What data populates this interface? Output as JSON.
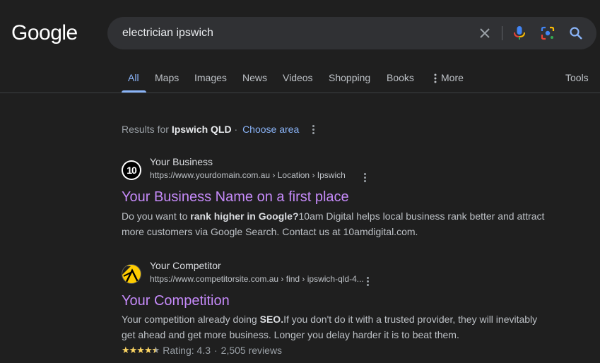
{
  "header": {
    "logo_text": "Google",
    "search": {
      "value": "electrician ipswich",
      "clear_icon": "close-icon",
      "voice_icon": "microphone-icon",
      "lens_icon": "camera-lens-icon",
      "search_icon": "search-icon"
    }
  },
  "tabs": [
    {
      "label": "All",
      "active": true
    },
    {
      "label": "Maps"
    },
    {
      "label": "Images"
    },
    {
      "label": "News"
    },
    {
      "label": "Videos"
    },
    {
      "label": "Shopping"
    },
    {
      "label": "Books"
    },
    {
      "label": "More"
    }
  ],
  "tools_label": "Tools",
  "location_bar": {
    "prefix": "Results for",
    "location": "Ipswich QLD",
    "separator": "·",
    "choose_area": "Choose area"
  },
  "results": [
    {
      "site_name": "Your Business",
      "url": "https://www.yourdomain.com.au › Location › Ipswich",
      "title": "Your Business Name on a first place",
      "snippet_pre": "Do you want to ",
      "snippet_bold": "rank higher in Google?",
      "snippet_post": "10am Digital helps local business rank better and attract more customers via Google Search. Contact us at 10amdigital.com.",
      "favicon_text": "10"
    },
    {
      "site_name": "Your Competitor",
      "url": "https://www.competitorsite.com.au › find › ipswich-qld-4...",
      "title": "Your Competition",
      "snippet_pre": "Your competition already doing ",
      "snippet_bold": "SEO.",
      "snippet_post": "If you don't do it with a trusted provider, they will inevitably get ahead and get more business. Longer you delay harder it is to beat them.",
      "rating": {
        "stars": 4.3,
        "text": "Rating: 4.3",
        "separator": "·",
        "reviews": "2,505 reviews"
      }
    }
  ],
  "colors": {
    "background": "#1f1f1f",
    "search_bg": "#303134",
    "link_blue": "#8ab4f8",
    "visited_title": "#c58af9",
    "star_yellow": "#fdd663"
  }
}
